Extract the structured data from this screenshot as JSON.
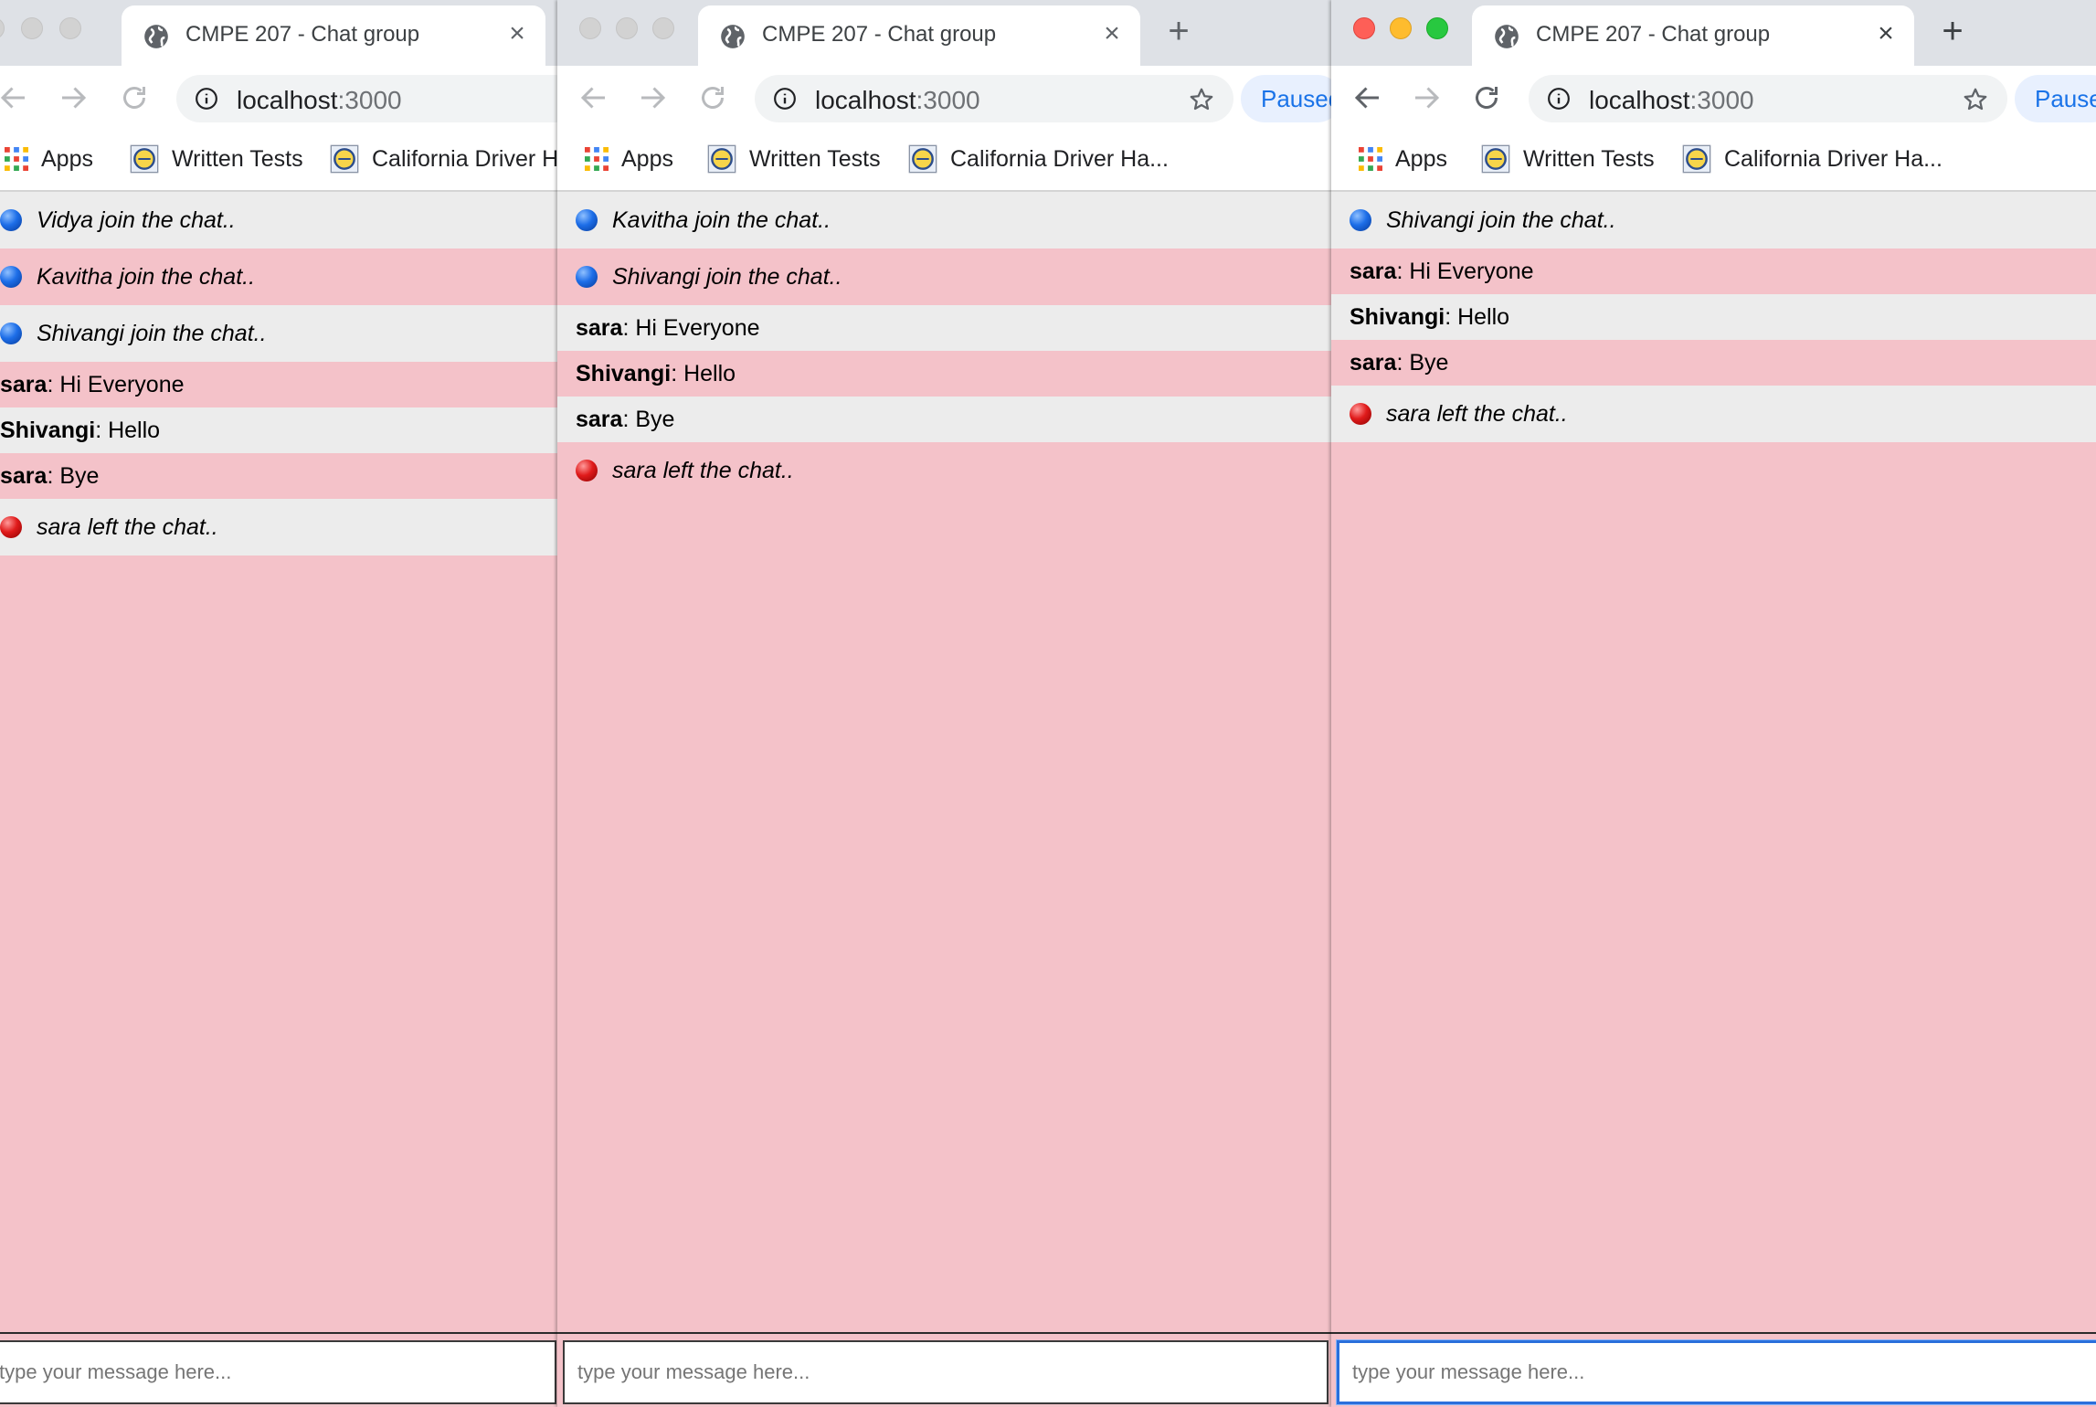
{
  "tab_title": "CMPE 207 - Chat group",
  "url": {
    "host": "localhost",
    "port": ":3000"
  },
  "paused_label": "Paused",
  "bookmarks": {
    "apps": "Apps",
    "written_tests": "Written Tests",
    "california": "California Driver Ha...",
    "california_full": "California Driver Ha"
  },
  "composer": {
    "placeholder": "type your message here..."
  },
  "windows": [
    {
      "messages": [
        {
          "type": "status",
          "icon": "blue-dot",
          "text": "Vidya join the chat.."
        },
        {
          "type": "status",
          "icon": "blue-dot",
          "text": "Kavitha join the chat.."
        },
        {
          "type": "status",
          "icon": "blue-dot",
          "text": "Shivangi join the chat.."
        },
        {
          "type": "chat",
          "sender": "sara",
          "text": ": Hi Everyone"
        },
        {
          "type": "chat",
          "sender": "Shivangi",
          "text": ": Hello"
        },
        {
          "type": "chat",
          "sender": "sara",
          "text": ": Bye"
        },
        {
          "type": "status",
          "icon": "red-dot",
          "text": "sara left the chat.."
        }
      ]
    },
    {
      "messages": [
        {
          "type": "status",
          "icon": "blue-dot",
          "text": "Kavitha join the chat.."
        },
        {
          "type": "status",
          "icon": "blue-dot",
          "text": "Shivangi join the chat.."
        },
        {
          "type": "chat",
          "sender": "sara",
          "text": ": Hi Everyone"
        },
        {
          "type": "chat",
          "sender": "Shivangi",
          "text": ": Hello"
        },
        {
          "type": "chat",
          "sender": "sara",
          "text": ": Bye"
        },
        {
          "type": "status",
          "icon": "red-dot",
          "text": "sara left the chat.."
        }
      ]
    },
    {
      "messages": [
        {
          "type": "status",
          "icon": "blue-dot",
          "text": "Shivangi join the chat.."
        },
        {
          "type": "chat",
          "sender": "sara",
          "text": ": Hi Everyone"
        },
        {
          "type": "chat",
          "sender": "Shivangi",
          "text": ": Hello"
        },
        {
          "type": "chat",
          "sender": "sara",
          "text": ": Bye"
        },
        {
          "type": "status",
          "icon": "red-dot",
          "text": "sara left the chat.."
        }
      ]
    }
  ],
  "colors": {
    "page_bg": "#f4c2c9",
    "row_alt": "#ececec",
    "join_dot": "#1d6ee8",
    "leave_dot": "#e01b1b",
    "focus": "#2a6fdb"
  }
}
